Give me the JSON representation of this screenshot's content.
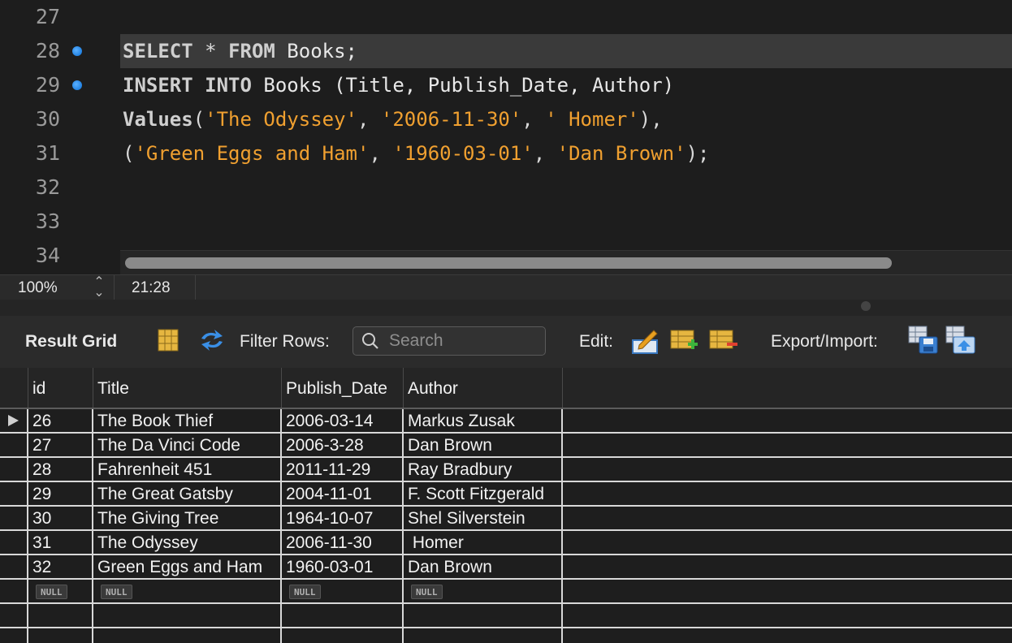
{
  "editor": {
    "lines": [
      {
        "num": "27",
        "marker": false,
        "current": false,
        "tokens": []
      },
      {
        "num": "28",
        "marker": true,
        "current": true,
        "tokens": [
          {
            "t": "SELECT",
            "c": "kw"
          },
          {
            "t": " * ",
            "c": "punc"
          },
          {
            "t": "FROM",
            "c": "kw"
          },
          {
            "t": " Books;",
            "c": "id"
          }
        ]
      },
      {
        "num": "29",
        "marker": true,
        "current": false,
        "tokens": [
          {
            "t": "INSERT",
            "c": "kw"
          },
          {
            "t": " ",
            "c": "punc"
          },
          {
            "t": "INTO",
            "c": "kw"
          },
          {
            "t": " Books (Title, Publish_Date, Author)",
            "c": "id"
          }
        ]
      },
      {
        "num": "30",
        "marker": false,
        "current": false,
        "tokens": [
          {
            "t": "Values",
            "c": "kw"
          },
          {
            "t": "(",
            "c": "punc"
          },
          {
            "t": "'The Odyssey'",
            "c": "str"
          },
          {
            "t": ", ",
            "c": "punc"
          },
          {
            "t": "'2006-11-30'",
            "c": "str"
          },
          {
            "t": ", ",
            "c": "punc"
          },
          {
            "t": "' Homer'",
            "c": "str"
          },
          {
            "t": "),",
            "c": "punc"
          }
        ]
      },
      {
        "num": "31",
        "marker": false,
        "current": false,
        "tokens": [
          {
            "t": "(",
            "c": "punc"
          },
          {
            "t": "'Green Eggs and Ham'",
            "c": "str"
          },
          {
            "t": ", ",
            "c": "punc"
          },
          {
            "t": "'1960-03-01'",
            "c": "str"
          },
          {
            "t": ", ",
            "c": "punc"
          },
          {
            "t": "'Dan Brown'",
            "c": "str"
          },
          {
            "t": ");",
            "c": "punc"
          }
        ]
      },
      {
        "num": "32",
        "marker": false,
        "current": false,
        "tokens": []
      },
      {
        "num": "33",
        "marker": false,
        "current": false,
        "tokens": []
      },
      {
        "num": "34",
        "marker": false,
        "current": false,
        "tokens": []
      }
    ]
  },
  "status": {
    "zoom": "100%",
    "cursor": "21:28"
  },
  "toolbar": {
    "result_grid_label": "Result Grid",
    "filter_label": "Filter Rows:",
    "search_placeholder": "Search",
    "edit_label": "Edit:",
    "export_label": "Export/Import:",
    "icons": [
      "grid-layout-icon",
      "refresh-icon",
      "search-icon",
      "edit-row-icon",
      "add-row-icon",
      "delete-row-icon",
      "export-icon",
      "import-icon"
    ]
  },
  "grid": {
    "columns": [
      "id",
      "Title",
      "Publish_Date",
      "Author"
    ],
    "rows": [
      [
        "26",
        "The Book Thief",
        "2006-03-14",
        "Markus Zusak"
      ],
      [
        "27",
        "The Da Vinci Code",
        "2006-3-28",
        "Dan Brown"
      ],
      [
        "28",
        "Fahrenheit 451",
        "2011-11-29",
        "Ray Bradbury"
      ],
      [
        "29",
        "The Great Gatsby",
        "2004-11-01",
        "F. Scott Fitzgerald"
      ],
      [
        "30",
        "The Giving Tree",
        "1964-10-07",
        "Shel Silverstein"
      ],
      [
        "31",
        "The Odyssey",
        "2006-11-30",
        " Homer"
      ],
      [
        "32",
        "Green Eggs and Ham",
        "1960-03-01",
        "Dan Brown"
      ]
    ],
    "null_label": "NULL",
    "empty_rows": 2
  },
  "colors": {
    "string": "#f0a030",
    "marker": "#1e7fe0",
    "background": "#1d1d1d"
  }
}
